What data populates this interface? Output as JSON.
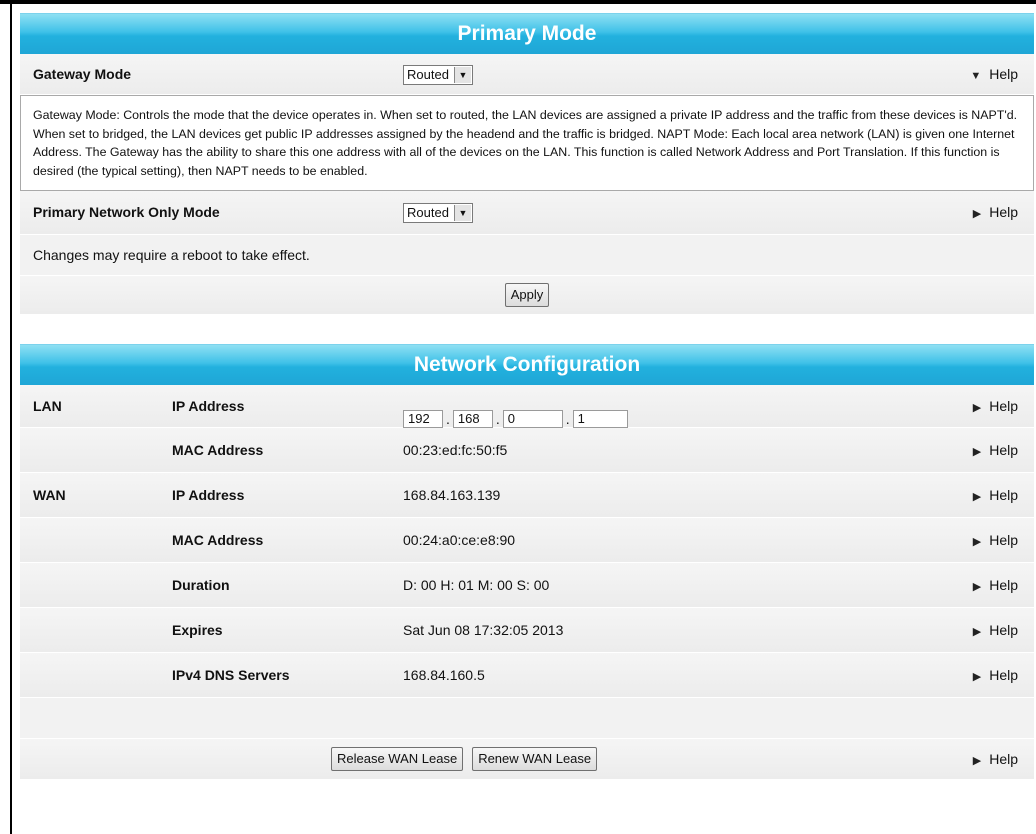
{
  "primary_mode": {
    "title": "Primary Mode",
    "gateway_mode": {
      "label": "Gateway Mode",
      "selected": "Routed",
      "help": "Help"
    },
    "help_text": "Gateway Mode: Controls the mode that the device operates in. When set to routed, the LAN devices are assigned a private IP address and the traffic from these devices is NAPT'd. When set to bridged, the LAN devices get public IP addresses assigned by the headend and the traffic is bridged. NAPT Mode: Each local area network (LAN) is given one Internet Address. The Gateway has the ability to share this one address with all of the devices on the LAN. This function is called Network Address and Port Translation. If this function is desired (the typical setting), then NAPT needs to be enabled.",
    "primary_network_only": {
      "label": "Primary Network Only Mode",
      "selected": "Routed",
      "help": "Help"
    },
    "reboot_note": "Changes may require a reboot to take effect.",
    "apply_label": "Apply"
  },
  "network_config": {
    "title": "Network Configuration",
    "lan_label": "LAN",
    "wan_label": "WAN",
    "lan_ip": {
      "label": "IP Address",
      "octets": [
        "192",
        "168",
        "0",
        "1"
      ],
      "help": "Help"
    },
    "lan_mac": {
      "label": "MAC Address",
      "value": "00:23:ed:fc:50:f5",
      "help": "Help"
    },
    "wan_ip": {
      "label": "IP Address",
      "value": "168.84.163.139",
      "help": "Help"
    },
    "wan_mac": {
      "label": "MAC Address",
      "value": "00:24:a0:ce:e8:90",
      "help": "Help"
    },
    "duration": {
      "label": "Duration",
      "value": "D: 00 H: 01 M: 00 S: 00",
      "help": "Help"
    },
    "expires": {
      "label": "Expires",
      "value": "Sat Jun 08 17:32:05 2013",
      "help": "Help"
    },
    "dns": {
      "label": "IPv4 DNS Servers",
      "value": "168.84.160.5",
      "help": "Help"
    },
    "release_label": "Release WAN Lease",
    "renew_label": "Renew WAN Lease",
    "footer_help": "Help"
  },
  "icons": {
    "expanded": "triangle-down-icon",
    "collapsed": "triangle-right-icon"
  }
}
